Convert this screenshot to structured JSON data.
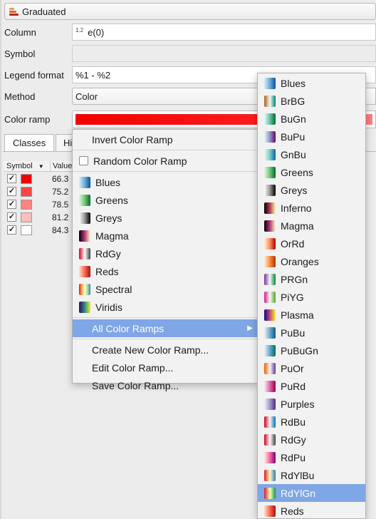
{
  "renderer": {
    "label": "Graduated"
  },
  "form": {
    "column_label": "Column",
    "column_badge": "1.2",
    "column_value": "e(0)",
    "symbol_label": "Symbol",
    "legend_format_label": "Legend format",
    "legend_format_value": "%1 - %2",
    "method_label": "Method",
    "method_value": "Color",
    "color_ramp_label": "Color ramp"
  },
  "tabs": {
    "classes": "Classes",
    "histogram": "Hi"
  },
  "table": {
    "headers": [
      "Symbol",
      "Value"
    ],
    "rows": [
      {
        "checked": true,
        "color": "#f20000",
        "value": "66.3"
      },
      {
        "checked": true,
        "color": "#ff4545",
        "value": "75.2"
      },
      {
        "checked": true,
        "color": "#ff8181",
        "value": "78.5"
      },
      {
        "checked": true,
        "color": "#ffbdbd",
        "value": "81.2"
      },
      {
        "checked": true,
        "color": "#ffffff",
        "value": "84.3"
      }
    ]
  },
  "menu": {
    "invert": "Invert Color Ramp",
    "random": "Random Color Ramp",
    "favorites": [
      {
        "label": "Blues",
        "colors": [
          "#deebf7",
          "#6baed6",
          "#08519c"
        ]
      },
      {
        "label": "Greens",
        "colors": [
          "#e5f5e0",
          "#74c476",
          "#006d2c"
        ]
      },
      {
        "label": "Greys",
        "colors": [
          "#ffffff",
          "#969696",
          "#000000"
        ]
      },
      {
        "label": "Magma",
        "colors": [
          "#000004",
          "#b63679",
          "#fcfdbf"
        ]
      },
      {
        "label": "RdGy",
        "colors": [
          "#ca0020",
          "#ffffff",
          "#404040"
        ]
      },
      {
        "label": "Reds",
        "colors": [
          "#fee0d2",
          "#fb6a4a",
          "#a50f15"
        ]
      },
      {
        "label": "Spectral",
        "colors": [
          "#d7191c",
          "#fdae61",
          "#ffffbf",
          "#abdda4",
          "#2b83ba"
        ]
      },
      {
        "label": "Viridis",
        "colors": [
          "#440154",
          "#21918c",
          "#fde725"
        ]
      }
    ],
    "all_ramps": "All Color Ramps",
    "create": "Create New Color Ramp...",
    "edit": "Edit Color Ramp...",
    "save": "Save Color Ramp..."
  },
  "submenu": {
    "selected": "RdYlGn",
    "items": [
      {
        "label": "Blues",
        "colors": [
          "#deebf7",
          "#6baed6",
          "#08519c"
        ]
      },
      {
        "label": "BrBG",
        "colors": [
          "#a6611a",
          "#f5f5f5",
          "#018571"
        ]
      },
      {
        "label": "BuGn",
        "colors": [
          "#edf8fb",
          "#66c2a4",
          "#006d2c"
        ]
      },
      {
        "label": "BuPu",
        "colors": [
          "#edf8fb",
          "#8c96c6",
          "#6e016b"
        ]
      },
      {
        "label": "GnBu",
        "colors": [
          "#f0f9e8",
          "#7bccc4",
          "#0868ac"
        ]
      },
      {
        "label": "Greens",
        "colors": [
          "#e5f5e0",
          "#74c476",
          "#006d2c"
        ]
      },
      {
        "label": "Greys",
        "colors": [
          "#ffffff",
          "#969696",
          "#000000"
        ]
      },
      {
        "label": "Inferno",
        "colors": [
          "#000004",
          "#bc3754",
          "#fcffa4"
        ]
      },
      {
        "label": "Magma",
        "colors": [
          "#000004",
          "#b63679",
          "#fcfdbf"
        ]
      },
      {
        "label": "OrRd",
        "colors": [
          "#fef0d9",
          "#fc8d59",
          "#b30000"
        ]
      },
      {
        "label": "Oranges",
        "colors": [
          "#feedde",
          "#fd8d3c",
          "#a63603"
        ]
      },
      {
        "label": "PRGn",
        "colors": [
          "#7b3294",
          "#f7f7f7",
          "#008837"
        ]
      },
      {
        "label": "PiYG",
        "colors": [
          "#d01c8b",
          "#f7f7f7",
          "#4dac26"
        ]
      },
      {
        "label": "Plasma",
        "colors": [
          "#0d0887",
          "#cc4778",
          "#f0f921"
        ]
      },
      {
        "label": "PuBu",
        "colors": [
          "#f1eef6",
          "#74a9cf",
          "#045a8d"
        ]
      },
      {
        "label": "PuBuGn",
        "colors": [
          "#f6eff7",
          "#67a9cf",
          "#016c59"
        ]
      },
      {
        "label": "PuOr",
        "colors": [
          "#e66101",
          "#f7f7f7",
          "#5e3c99"
        ]
      },
      {
        "label": "PuRd",
        "colors": [
          "#f1eef6",
          "#df65b0",
          "#980043"
        ]
      },
      {
        "label": "Purples",
        "colors": [
          "#f2f0f7",
          "#9e9ac8",
          "#54278f"
        ]
      },
      {
        "label": "RdBu",
        "colors": [
          "#ca0020",
          "#f7f7f7",
          "#0571b0"
        ]
      },
      {
        "label": "RdGy",
        "colors": [
          "#ca0020",
          "#ffffff",
          "#404040"
        ]
      },
      {
        "label": "RdPu",
        "colors": [
          "#feebe2",
          "#f768a1",
          "#7a0177"
        ]
      },
      {
        "label": "RdYlBu",
        "colors": [
          "#d7191c",
          "#ffffbf",
          "#2c7bb6"
        ]
      },
      {
        "label": "RdYlGn",
        "colors": [
          "#d7191c",
          "#ffffbf",
          "#1a9641"
        ]
      },
      {
        "label": "Reds",
        "colors": [
          "#fee0d2",
          "#fb6a4a",
          "#a50f15"
        ]
      }
    ]
  }
}
